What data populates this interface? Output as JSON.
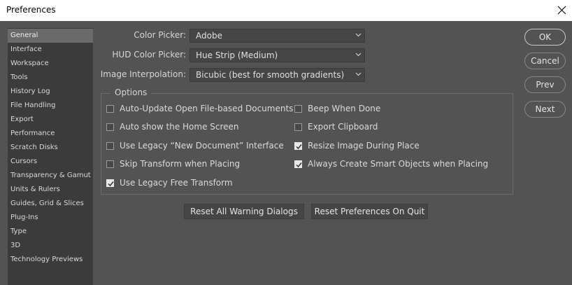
{
  "window": {
    "title": "Preferences"
  },
  "sidebar": {
    "items": [
      {
        "label": "General",
        "active": true
      },
      {
        "label": "Interface"
      },
      {
        "label": "Workspace"
      },
      {
        "label": "Tools"
      },
      {
        "label": "History Log"
      },
      {
        "label": "File Handling"
      },
      {
        "label": "Export"
      },
      {
        "label": "Performance"
      },
      {
        "label": "Scratch Disks"
      },
      {
        "label": "Cursors"
      },
      {
        "label": "Transparency & Gamut"
      },
      {
        "label": "Units & Rulers"
      },
      {
        "label": "Guides, Grid & Slices"
      },
      {
        "label": "Plug-Ins"
      },
      {
        "label": "Type"
      },
      {
        "label": "3D"
      },
      {
        "label": "Technology Previews"
      }
    ]
  },
  "form": {
    "color_picker": {
      "label": "Color Picker:",
      "value": "Adobe"
    },
    "hud_color_picker": {
      "label": "HUD Color Picker:",
      "value": "Hue Strip (Medium)"
    },
    "image_interpolation": {
      "label": "Image Interpolation:",
      "value": "Bicubic (best for smooth gradients)"
    }
  },
  "options": {
    "legend": "Options",
    "left": [
      {
        "label": "Auto-Update Open File-based Documents",
        "checked": false
      },
      {
        "label": "Auto show the Home Screen",
        "checked": false
      },
      {
        "label": "Use Legacy “New Document” Interface",
        "checked": false
      },
      {
        "label": "Skip Transform when Placing",
        "checked": false
      },
      {
        "label": "Use Legacy Free Transform",
        "checked": true
      }
    ],
    "right": [
      {
        "label": "Beep When Done",
        "checked": false
      },
      {
        "label": "Export Clipboard",
        "checked": false
      },
      {
        "label": "Resize Image During Place",
        "checked": true
      },
      {
        "label": "Always Create Smart Objects when Placing",
        "checked": true
      }
    ]
  },
  "buttons": {
    "reset_warnings": "Reset All Warning Dialogs",
    "reset_prefs": "Reset Preferences On Quit",
    "ok": "OK",
    "cancel": "Cancel",
    "prev": "Prev",
    "next": "Next"
  },
  "icons": {
    "close": "close-icon",
    "chevron": "chevron-down-icon",
    "check": "checkmark-icon"
  }
}
